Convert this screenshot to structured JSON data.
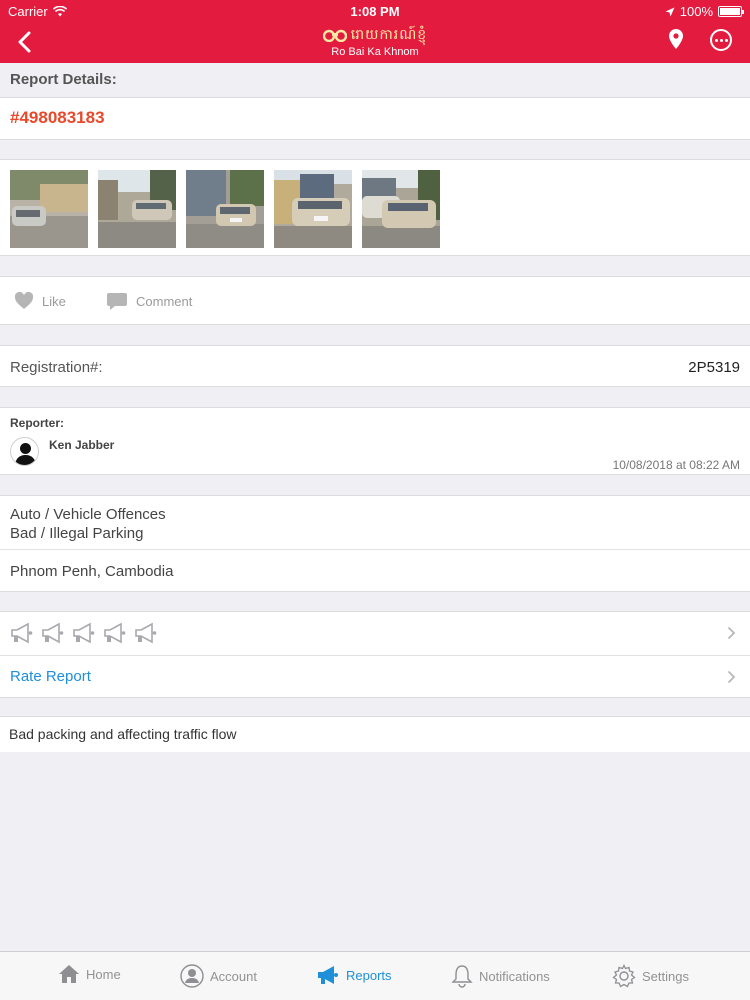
{
  "status_bar": {
    "carrier": "Carrier",
    "time": "1:08 PM",
    "battery": "100%"
  },
  "header": {
    "app_name_khmer": "រោយការណ៍ខ្ញុំ",
    "app_name": "Ro Bai Ka Khnom",
    "accent": "#e31b3f"
  },
  "report": {
    "section_title": "Report Details:",
    "id": "#498083183",
    "photo_count": 5,
    "like_label": "Like",
    "comment_label": "Comment",
    "registration_label": "Registration#:",
    "registration_value": "2P5319",
    "reporter_label": "Reporter:",
    "reporter_name": "Ken Jabber",
    "reported_at": "10/08/2018 at 08:22 AM",
    "category": "Auto / Vehicle Offences",
    "subcategory": "Bad / Illegal Parking",
    "location": "Phnom Penh, Cambodia",
    "rating_icons": 5,
    "rate_label": "Rate Report",
    "description": "Bad packing and affecting traffic flow"
  },
  "tabs": [
    {
      "label": "Home",
      "icon": "home-icon"
    },
    {
      "label": "Account",
      "icon": "account-icon"
    },
    {
      "label": "Reports",
      "icon": "megaphone-icon",
      "active": true
    },
    {
      "label": "Notifications",
      "icon": "bell-icon"
    },
    {
      "label": "Settings",
      "icon": "gear-icon"
    }
  ]
}
